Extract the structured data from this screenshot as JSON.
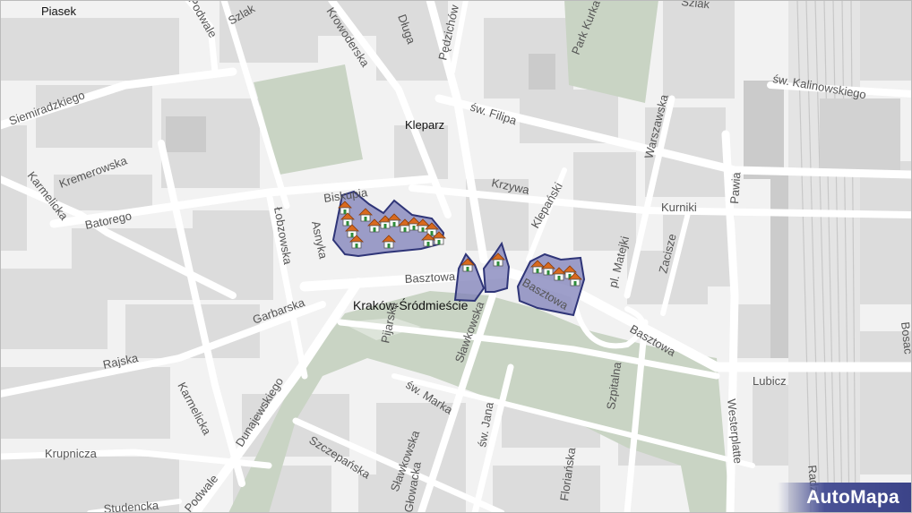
{
  "map": {
    "districts": [
      "Piasek",
      "Kleparz",
      "Kraków-Śródmieście"
    ],
    "streets": [
      "Szlak",
      "Krowoderska",
      "Długa",
      "Pędzichów",
      "Park Kurka",
      "Siemiradzkiego",
      "św. Kalinowskiego",
      "św. Filipa",
      "Warszawska",
      "Kremerowska",
      "Biskupia",
      "Krzywa",
      "Karmelicka",
      "Batorego",
      "Asnyka",
      "Łobzowska",
      "Kurniki",
      "Pawia",
      "Klepański",
      "pl. Matejki",
      "Zacisze",
      "Basztowa",
      "Garbarska",
      "Pijarska",
      "Sławkowska",
      "Rajska",
      "św. Marka",
      "Lubicz",
      "Szpitalna",
      "Westerplatte",
      "Dunajewskiego",
      "Szczepańska",
      "św. Jana",
      "Krupnicza",
      "Studencka",
      "Podwale",
      "Radz",
      "Bosac",
      "Szlak",
      "Głowacka",
      "Floriańska",
      "Basztowa",
      "Basztowa"
    ],
    "brand": "AutoMapa",
    "colors": {
      "background": "#f2f2f2",
      "block": "#dcdcdc",
      "park": "#c9d4c4",
      "road": "#ffffff",
      "highlight_fill": "#7d7fb8",
      "highlight_stroke": "#2f3578",
      "brand_bg": "#4a5296"
    },
    "markers": "house-icon"
  }
}
